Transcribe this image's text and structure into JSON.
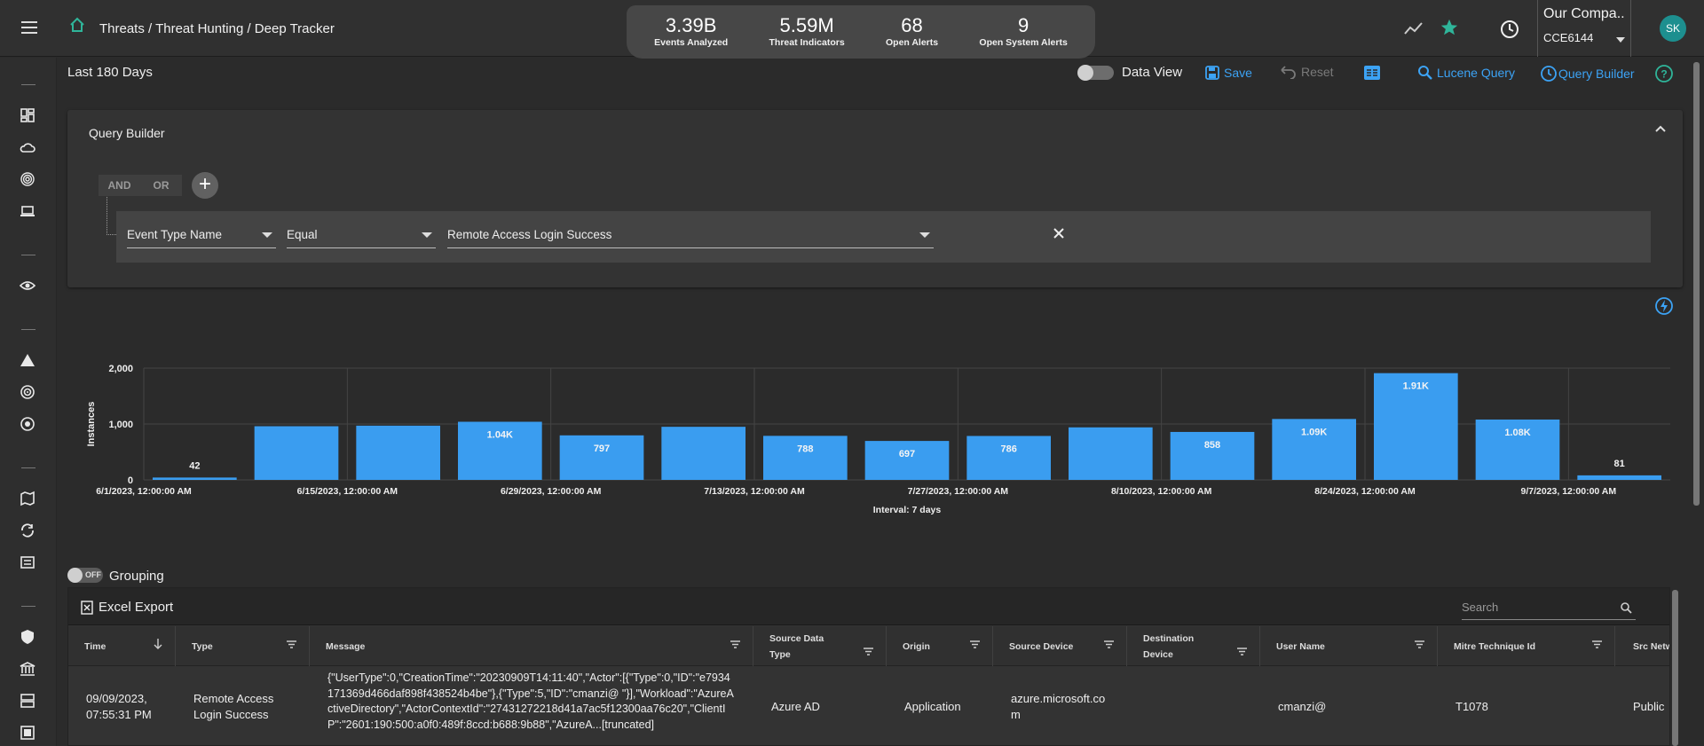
{
  "header": {
    "breadcrumb": "Threats / Threat Hunting / Deep Tracker",
    "stats": [
      {
        "value": "3.39B",
        "label": "Events Analyzed"
      },
      {
        "value": "5.59M",
        "label": "Threat Indicators"
      },
      {
        "value": "68",
        "label": "Open Alerts"
      },
      {
        "value": "9",
        "label": "Open System Alerts"
      }
    ],
    "company": "Our Compa...",
    "company_code": "CCE6144",
    "avatar": "SK",
    "accent_color": "#2fb59a"
  },
  "toolbar": {
    "range": "Last 180 Days",
    "data_view": "Data View",
    "save": "Save",
    "reset": "Reset",
    "lucene": "Lucene Query",
    "query_builder": "Query Builder",
    "link_color": "#3ca3f5"
  },
  "query_builder": {
    "title": "Query Builder",
    "and": "AND",
    "or": "OR",
    "add": "+",
    "field": "Event Type Name",
    "operator": "Equal",
    "value": "Remote Access Login Success"
  },
  "chart_data": {
    "type": "bar",
    "ylabel": "Instances",
    "xlabel": "Interval: 7 days",
    "ylim": [
      0,
      2000
    ],
    "yticks": [
      "0",
      "1,000",
      "2,000"
    ],
    "xticks": [
      "6/1/2023, 12:00:00 AM",
      "6/15/2023, 12:00:00 AM",
      "6/29/2023, 12:00:00 AM",
      "7/13/2023, 12:00:00 AM",
      "7/27/2023, 12:00:00 AM",
      "8/10/2023, 12:00:00 AM",
      "8/24/2023, 12:00:00 AM",
      "9/7/2023, 12:00:00 AM"
    ],
    "values": [
      42,
      960,
      970,
      1040,
      797,
      950,
      788,
      697,
      786,
      940,
      858,
      1090,
      1910,
      1080,
      81
    ],
    "bar_labels": [
      "42",
      "",
      "",
      "1.04K",
      "797",
      "",
      "788",
      "697",
      "786",
      "",
      "858",
      "1.09K",
      "1.91K",
      "1.08K",
      "81"
    ],
    "bar_color": "#3a9df0"
  },
  "grouping": {
    "label": "Grouping",
    "state": "OFF"
  },
  "table": {
    "export": "Excel Export",
    "search_placeholder": "Search",
    "columns": [
      "Time",
      "Type",
      "Message",
      "Source Data Type",
      "Origin",
      "Source Device",
      "Destination Device",
      "User Name",
      "Mitre Technique Id",
      "Src Netwo"
    ],
    "row": {
      "time": "09/09/2023, 07:55:31 PM",
      "type": "Remote Access Login Success",
      "message": "{\"UserType\":0,\"CreationTime\":\"20230909T14:11:40\",\"Actor\":[{\"Type\":0,\"ID\":\"e7934171369d466daf898f438524b4be\"},{\"Type\":5,\"ID\":\"cmanzi@                \"}],\"Workload\":\"AzureActiveDirectory\",\"ActorContextId\":\"27431272218d41a7ac5f12300aa76c20\",\"ClientIP\":\"2601:190:500:a0f0:489f:8ccd:b688:9b88\",\"AzureA...[truncated]",
      "source_data_type": "Azure AD",
      "origin": "Application",
      "source_device": "azure.microsoft.com",
      "destination_device": "",
      "user_name": "cmanzi@",
      "mitre": "T1078",
      "src_network": "Public"
    }
  }
}
